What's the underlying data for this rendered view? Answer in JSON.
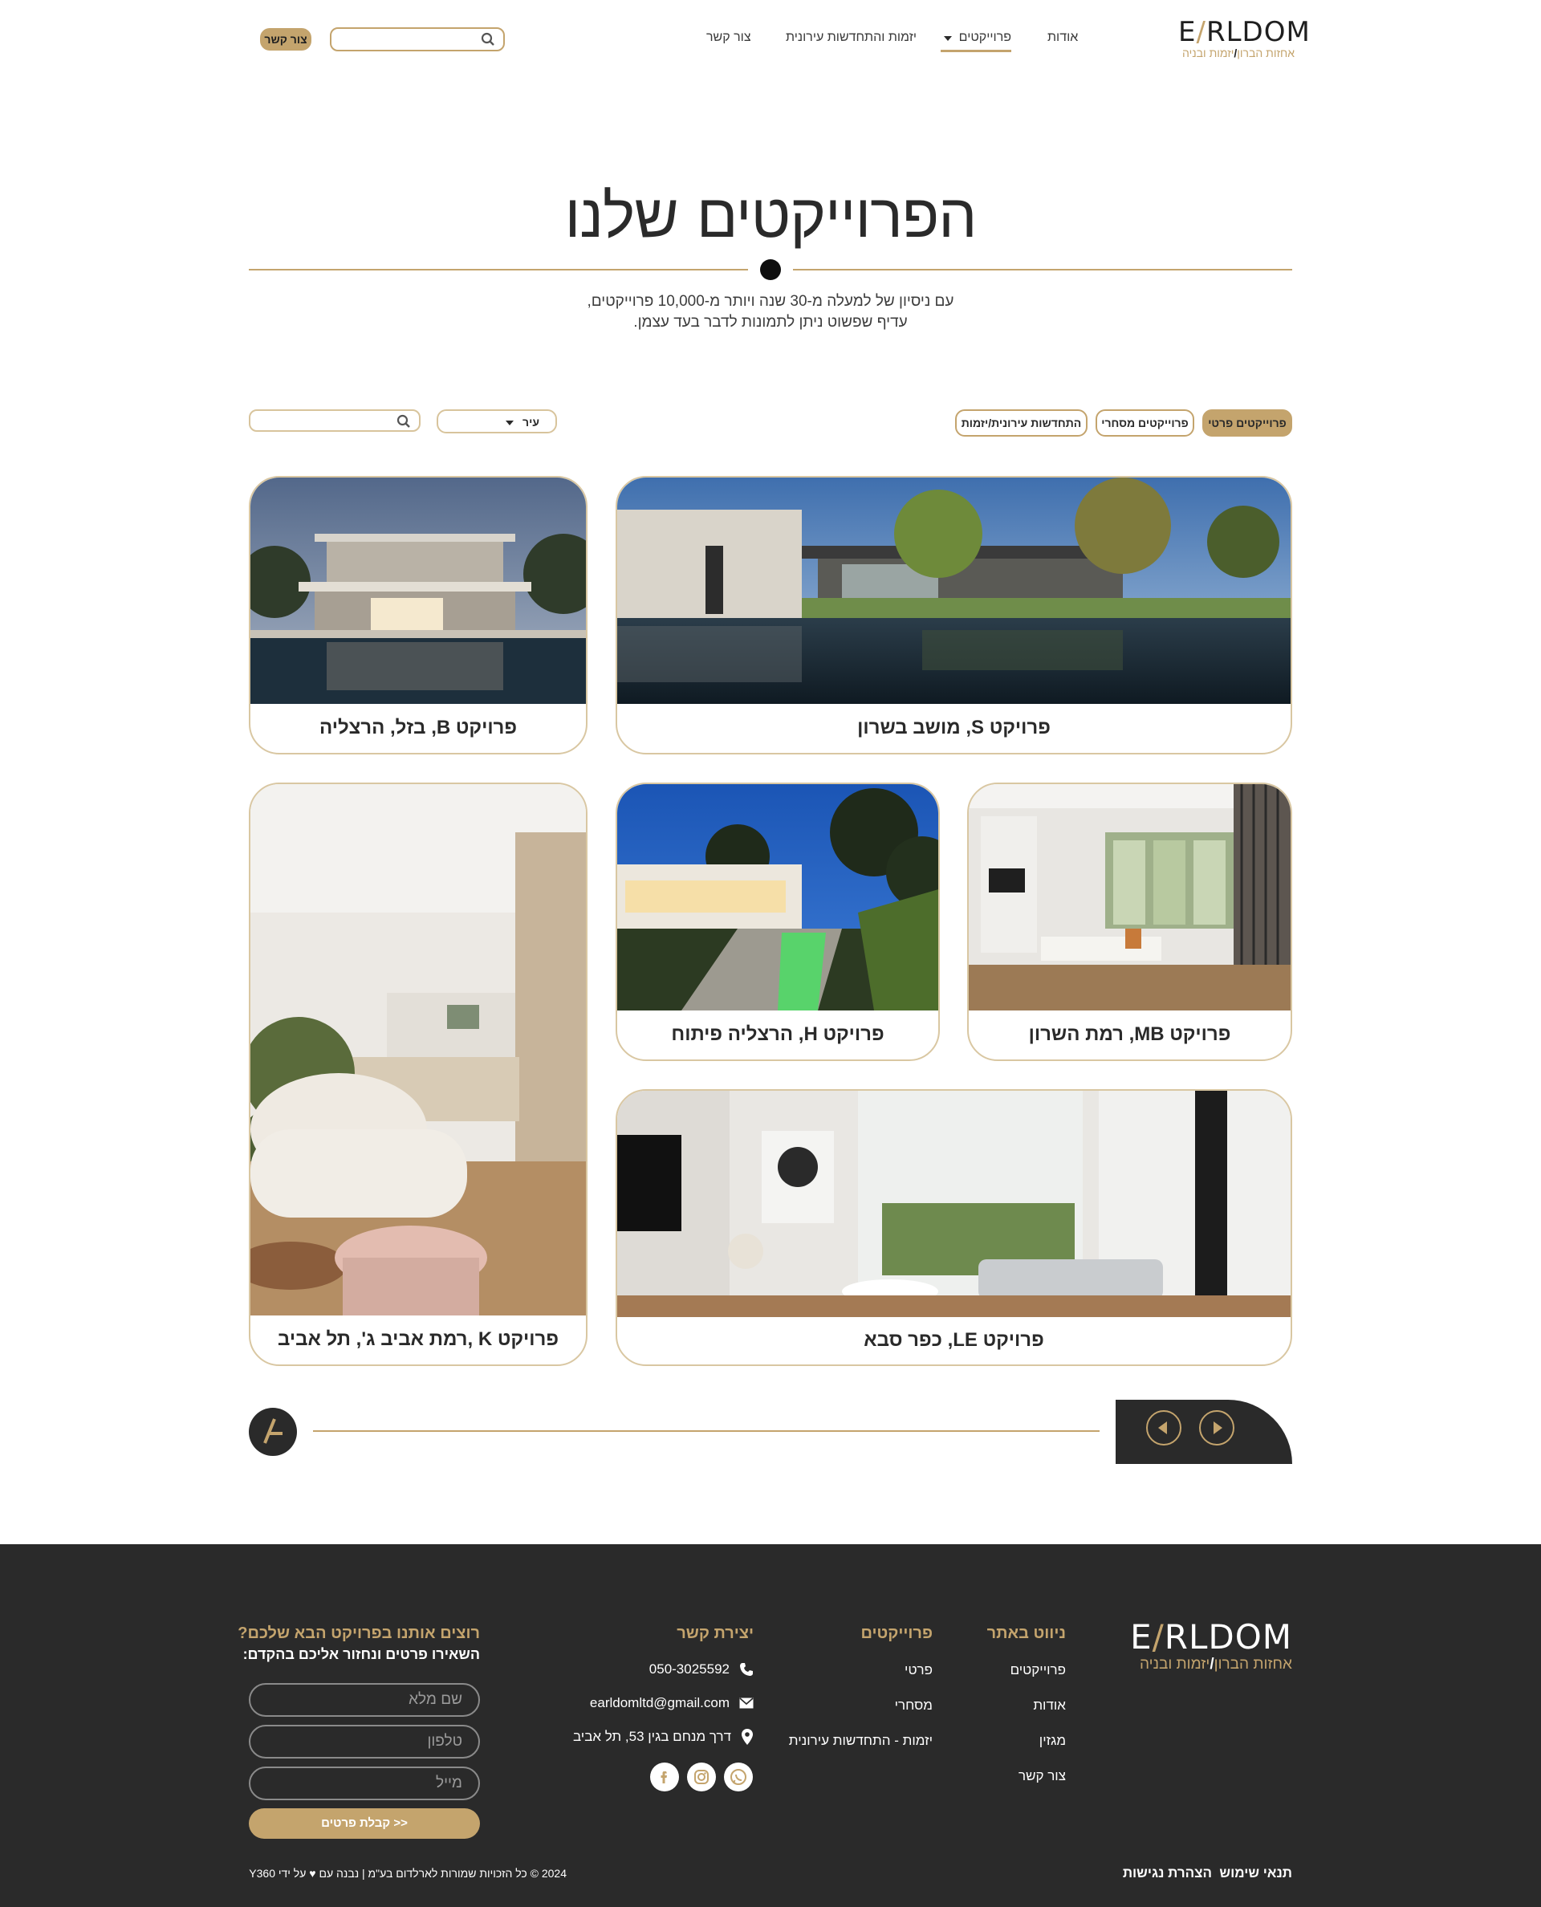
{
  "header": {
    "logo_word": "E/RLDOM",
    "logo_word_left": "E",
    "logo_word_right": "RLDOM",
    "logo_sub_left": "אחזות הברון",
    "logo_sub_right": "יזמות ובניה",
    "nav": [
      {
        "label": "אודות"
      },
      {
        "label": "פרוייקטים"
      },
      {
        "label": "יזמות והתחדשות עירונית"
      },
      {
        "label": "צור קשר"
      }
    ],
    "search_placeholder": "",
    "contact_button": "צור קשר"
  },
  "hero": {
    "title": "הפרוייקטים שלנו",
    "subtitle_line1": "עם ניסיון של למעלה מ-30 שנה ויותר מ-10,000 פרוייקטים,",
    "subtitle_line2": "עדיף שפשוט ניתן לתמונות לדבר בעד עצמן."
  },
  "filters": {
    "tabs": [
      "פרוייקטים פרטי",
      "פרוייקטים מסחרי",
      "התחדשות עירונית/יזמות"
    ],
    "city_label": "עיר",
    "search_placeholder": ""
  },
  "projects": [
    {
      "caption": "פרויקט S, מושב בשרון"
    },
    {
      "caption": "פרויקט B, בזל, הרצליה"
    },
    {
      "caption": "פרויקט MB, רמת השרון"
    },
    {
      "caption": "פרויקט H, הרצליה פיתוח"
    },
    {
      "caption": "פרויקט K ,רמת אביב ג', תל אביב"
    },
    {
      "caption": "פרויקט LE, כפר סבא"
    }
  ],
  "footer": {
    "logo_word_left": "E",
    "logo_word_right": "RLDOM",
    "logo_sub_left": "אחזות הברון",
    "logo_sub_right": "יזמות ובניה",
    "nav_title": "ניווט באתר",
    "nav_links": [
      "פרוייקטים",
      "אודות",
      "מגזין",
      "צור קשר"
    ],
    "projects_title": "פרוייקטים",
    "projects_links": [
      "פרטי",
      "מסחרי",
      "יזמות - התחדשות עירונית"
    ],
    "contact_title": "יצירת קשר",
    "phone": "050-3025592",
    "email": "earldomltd@gmail.com",
    "address": "דרך מנחם בגין 53, תל אביב",
    "form_title": "רוצים אותנו בפרויקט הבא שלכם?",
    "form_subtitle": "השאירו פרטים ונחזור אליכם בהקדם:",
    "field_name": "שם מלא",
    "field_phone": "טלפון",
    "field_email": "מייל",
    "submit": "<< קבלת פרטים",
    "terms": "תנאי שימוש",
    "accessibility": "הצהרת נגישות",
    "copyright": "2024 © כל הזכויות שמורות לארלדום בע\"מ | נבנה עם ♥ על ידי Y360"
  },
  "colors": {
    "accent": "#c4a46d",
    "dark": "#2a2a2a",
    "background": "#ffffff"
  }
}
